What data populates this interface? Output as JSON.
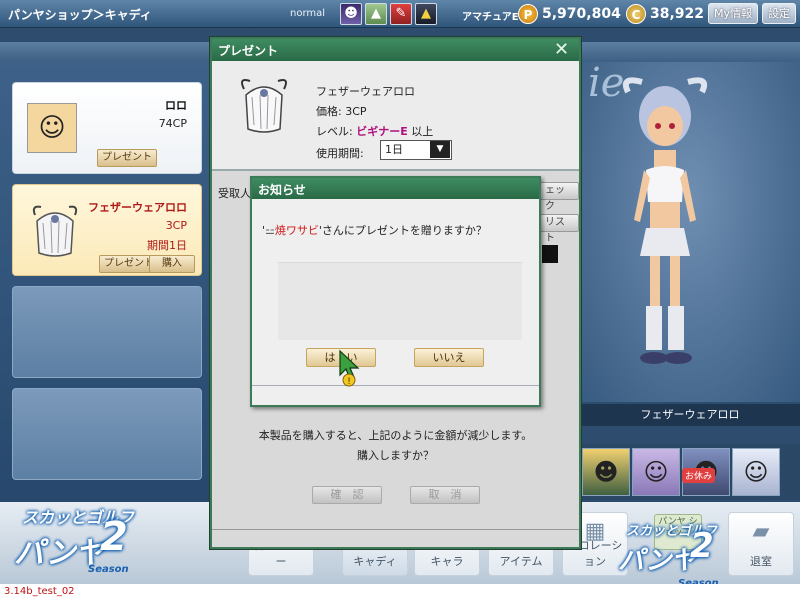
{
  "topbar": {
    "breadcrumb": "パンヤショップ＞キャディ",
    "status": "normal",
    "rank_label": "アマチュアE",
    "points": "5,970,804",
    "cash": "38,922",
    "myinfo_label": "My情報",
    "settings_label": "設定",
    "coin_p": "P",
    "coin_c": "C"
  },
  "cards": [
    {
      "name": "ロロ",
      "price": "74CP",
      "present_label": "プレゼント"
    },
    {
      "name": "フェザーウェアロロ",
      "price": "3CP",
      "period": "期間1日",
      "present_label": "プレゼント",
      "buy_label": "購入"
    }
  ],
  "stage": {
    "deco": "ie",
    "character_name": "フェザーウェアロロ",
    "oyasumi": "お休み"
  },
  "bottom_nav": {
    "shop_home": "パンヤ ショップ",
    "items": [
      "料金センター",
      "キャディ",
      "キャラ",
      "アイテム",
      "デコレーション",
      "退室"
    ]
  },
  "logo": {
    "kana": "スカッとゴルフ",
    "brand": "パンヤ",
    "num": "2",
    "season": "Season"
  },
  "version": "3.14b_test_02",
  "present_dialog": {
    "title": "プレゼント",
    "close": "✕",
    "item_name": "フェザーウェアロロ",
    "price_label": "価格:",
    "price_value": "3CP",
    "level_label": "レベル:",
    "level_value": "ビギナーE",
    "level_suffix": "以上",
    "period_label": "使用期間:",
    "period_value": "1日",
    "recipient_label": "受取人",
    "check_label": "ェック",
    "list_label": "リスト",
    "desc_line1": "本製品を購入すると、上記のように金額が減少します。",
    "desc_line2": "購入しますか？",
    "confirm_label": "確　認",
    "cancel_label": "取　消"
  },
  "notice_dialog": {
    "title": "お知らせ",
    "msg_open_quote": "'",
    "recipient_name": "焼ワサビ",
    "msg_rest": "'さんにプレゼントを贈りますか？",
    "yes_label": "は　い",
    "no_label": "いいえ"
  },
  "colors": {
    "dialog_green": "#3d7a58",
    "recipient_red": "#d01818",
    "level_magenta": "#b0107c"
  }
}
